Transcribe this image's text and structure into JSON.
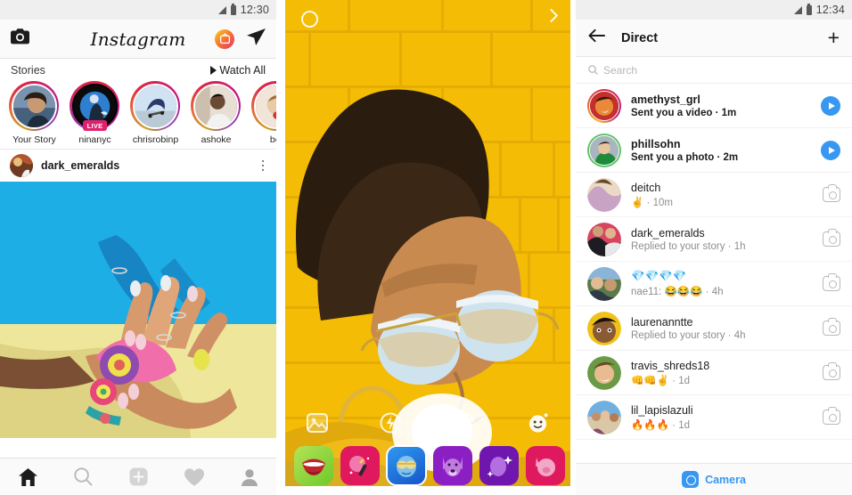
{
  "feed": {
    "statusbar": {
      "time": "12:30",
      "signal_icon": "signal-triangle-icon",
      "battery_icon": "battery-icon"
    },
    "header": {
      "camera_icon": "camera-icon",
      "logo": "Instagram",
      "igtv_icon": "igtv-icon",
      "direct_icon": "paper-plane-icon"
    },
    "stories": {
      "title": "Stories",
      "watch_all": "Watch All",
      "items": [
        {
          "name": "Your Story",
          "live": false,
          "live_label": ""
        },
        {
          "name": "ninanyc",
          "live": true,
          "live_label": "LIVE"
        },
        {
          "name": "chrisrobinp",
          "live": false,
          "live_label": ""
        },
        {
          "name": "ashoke",
          "live": false,
          "live_label": ""
        },
        {
          "name": "ber",
          "live": false,
          "live_label": ""
        }
      ]
    },
    "post": {
      "username": "dark_emeralds",
      "more_icon": "more-options-icon"
    },
    "tabbar": {
      "items": [
        {
          "icon": "home-icon",
          "active": true
        },
        {
          "icon": "search-icon",
          "active": false
        },
        {
          "icon": "add-post-icon",
          "active": false
        },
        {
          "icon": "heart-icon",
          "active": false
        },
        {
          "icon": "profile-icon",
          "active": false
        }
      ]
    }
  },
  "story_camera": {
    "close_icon": "story-ring-icon",
    "next_icon": "chevron-right-icon",
    "tools": [
      {
        "icon": "gallery-icon"
      },
      {
        "icon": "flash-icon"
      },
      {
        "icon": "rotate-camera-icon"
      },
      {
        "icon": "face-filter-icon"
      }
    ],
    "filters": [
      {
        "name": "lips-filter",
        "glyph": "👄",
        "bg": "#7ED321",
        "selected": false
      },
      {
        "name": "makeup-filter",
        "glyph": "💄",
        "bg": "#E91E63",
        "selected": false
      },
      {
        "name": "sunglasses-filter",
        "glyph": "😎",
        "bg": "#1E88E5",
        "selected": true
      },
      {
        "name": "dog-filter",
        "glyph": "🐶",
        "bg": "#8E24AA",
        "selected": false
      },
      {
        "name": "sparkle-filter",
        "glyph": "✨",
        "bg": "#7B1FA2",
        "selected": false
      },
      {
        "name": "pig-filter",
        "glyph": "🐷",
        "bg": "#E91E63",
        "selected": false
      }
    ]
  },
  "direct": {
    "statusbar": {
      "time": "12:34",
      "signal_icon": "signal-triangle-icon",
      "battery_icon": "battery-icon"
    },
    "header": {
      "back_icon": "back-arrow-icon",
      "title": "Direct",
      "new_message_icon": "plus-icon"
    },
    "search": {
      "placeholder": "Search",
      "icon": "search-icon"
    },
    "threads": [
      {
        "name": "amethyst_grl",
        "preview": "Sent you a video",
        "time": "1m",
        "unread": true,
        "ring": "gold",
        "action": "play-button"
      },
      {
        "name": "phillsohn",
        "preview": "Sent you a photo",
        "time": "2m",
        "unread": true,
        "ring": "green",
        "action": "play-button"
      },
      {
        "name": "deitch",
        "preview": "✌️",
        "time": "10m",
        "unread": false,
        "ring": "none",
        "action": "camera-button"
      },
      {
        "name": "dark_emeralds",
        "preview": "Replied to your story",
        "time": "1h",
        "unread": false,
        "ring": "none",
        "action": "camera-button"
      },
      {
        "name": "💎💎💎💎",
        "preview": "nae11: 😂😂😂",
        "time": "4h",
        "unread": false,
        "ring": "none",
        "action": "camera-button"
      },
      {
        "name": "laurenanntte",
        "preview": "Replied to your story",
        "time": "4h",
        "unread": false,
        "ring": "none",
        "action": "camera-button"
      },
      {
        "name": "travis_shreds18",
        "preview": "👊👊✌️",
        "time": "1d",
        "unread": false,
        "ring": "none",
        "action": "camera-button"
      },
      {
        "name": "lil_lapislazuli",
        "preview": "🔥🔥🔥",
        "time": "1d",
        "unread": false,
        "ring": "none",
        "action": "camera-button"
      }
    ],
    "footer": {
      "camera_icon": "camera-icon",
      "label": "Camera"
    }
  },
  "colors": {
    "accent_blue": "#3897f0",
    "live_pink": "#e0216e",
    "story_ring_start": "#c9a227",
    "story_ring_end": "#bc1888",
    "muted_text": "#8e8e8e"
  }
}
